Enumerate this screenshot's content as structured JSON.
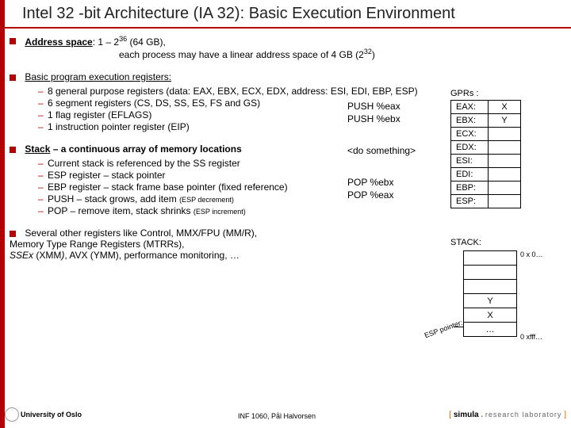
{
  "title": "Intel 32 -bit Architecture (IA 32): Basic Execution Environment",
  "sec1": {
    "head_b": "Address space",
    "head_rest": ": 1 – 2",
    "exp1": "36",
    "after_exp1": " (64 GB),",
    "line2_a": "each process may have a linear address space of 4 GB (2",
    "exp2": "32",
    "line2_b": ")"
  },
  "sec2": {
    "head": "Basic program execution registers:",
    "items": [
      "8 general purpose registers (data: EAX, EBX, ECX, EDX, address: ESI, EDI, EBP, ESP)",
      "6 segment registers (CS, DS, SS, ES, FS and GS)",
      "1 flag register (EFLAGS)",
      "1 instruction pointer register (EIP)"
    ]
  },
  "sec3": {
    "head_b": "Stack",
    "head_rest": " – a continuous array of memory locations",
    "items_pre": [
      "Current stack is referenced by the SS register",
      "ESP register – stack pointer",
      "EBP register – stack frame base pointer (fixed reference)"
    ],
    "push_a": "PUSH – stack grows, add item ",
    "push_b": "(ESP decrement)",
    "pop_a": "POP – remove item, stack shrinks ",
    "pop_b": "(ESP increment)"
  },
  "sec4": {
    "text_a": "Several other registers like Control, MMX/FPU (MM/R),",
    "text_b": "Memory Type Range Registers (MTRRs),",
    "text_c_i": "SSEx",
    "text_c_m": " (XMM",
    "text_c_i2": ")",
    "text_c_rest": ", AVX (YMM), performance monitoring, …"
  },
  "pushblock": {
    "l1": "PUSH %eax",
    "l2": "PUSH %ebx",
    "l3": "<do something>",
    "l4": "POP %ebx",
    "l5": "POP %eax"
  },
  "gpr": {
    "label": "GPRs :",
    "rows": [
      {
        "l": "EAX:",
        "r": "X"
      },
      {
        "l": "EBX:",
        "r": "Y"
      },
      {
        "l": "ECX:",
        "r": ""
      },
      {
        "l": "EDX:",
        "r": ""
      },
      {
        "l": "ESI:",
        "r": ""
      },
      {
        "l": "EDI:",
        "r": ""
      },
      {
        "l": "EBP:",
        "r": ""
      },
      {
        "l": "ESP:",
        "r": ""
      }
    ]
  },
  "stack": {
    "label": "STACK:",
    "cells": [
      "",
      "",
      "",
      "Y",
      "X",
      "…"
    ],
    "addr0": "0 x 0…",
    "addrF": "0 xfff…",
    "esp": "ESP pointer:"
  },
  "footer": {
    "uio": "University of Oslo",
    "inf": "INF 1060, Pål Halvorsen",
    "br1": "[ ",
    "sim": "simula",
    "dot": " . ",
    "rl": "research laboratory",
    "br2": " ]"
  }
}
